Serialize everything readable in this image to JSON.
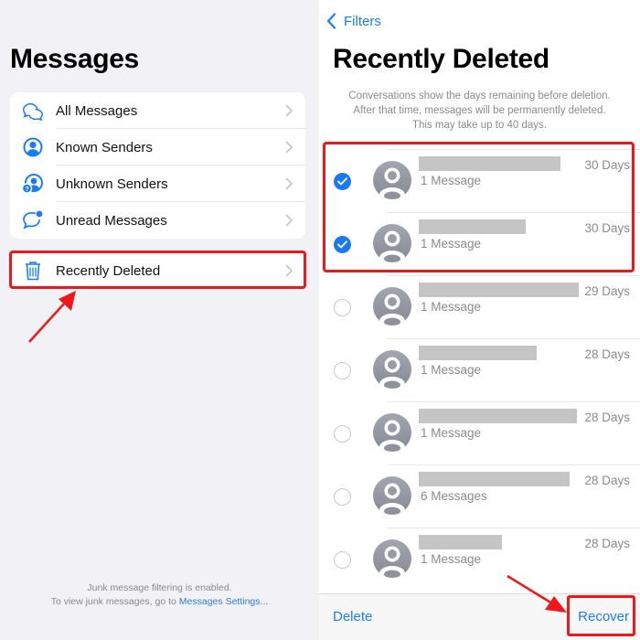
{
  "left_panel": {
    "title": "Messages",
    "filters": [
      {
        "label": "All Messages",
        "icon": "chat-bubbles-icon"
      },
      {
        "label": "Known Senders",
        "icon": "person-circle-icon"
      },
      {
        "label": "Unknown Senders",
        "icon": "person-question-icon"
      },
      {
        "label": "Unread Messages",
        "icon": "unread-bubble-icon"
      }
    ],
    "recently_deleted": {
      "label": "Recently Deleted",
      "icon": "trash-icon"
    },
    "footer": {
      "line1": "Junk message filtering is enabled.",
      "line2_prefix": "To view junk messages, go to ",
      "line2_link": "Messages Settings..."
    }
  },
  "right_panel": {
    "back_label": "Filters",
    "title": "Recently Deleted",
    "description": [
      "Conversations show the days remaining before deletion.",
      "After that time, messages will be permanently deleted.",
      "This may take up to 40 days."
    ],
    "conversations": [
      {
        "selected": true,
        "subtitle": "1 Message",
        "days": "30 Days"
      },
      {
        "selected": true,
        "subtitle": "1 Message",
        "days": "30 Days"
      },
      {
        "selected": false,
        "subtitle": "1 Message",
        "days": "29 Days"
      },
      {
        "selected": false,
        "subtitle": "1 Message",
        "days": "28 Days"
      },
      {
        "selected": false,
        "subtitle": "1 Message",
        "days": "28 Days"
      },
      {
        "selected": false,
        "subtitle": "6 Messages",
        "days": "28 Days"
      },
      {
        "selected": false,
        "subtitle": "1 Message",
        "days": "28 Days"
      }
    ],
    "toolbar": {
      "delete_label": "Delete",
      "recover_label": "Recover"
    }
  },
  "colors": {
    "accent": "#1a7cf5",
    "highlight": "#f0171b",
    "redaction": "#c5c5c5"
  }
}
